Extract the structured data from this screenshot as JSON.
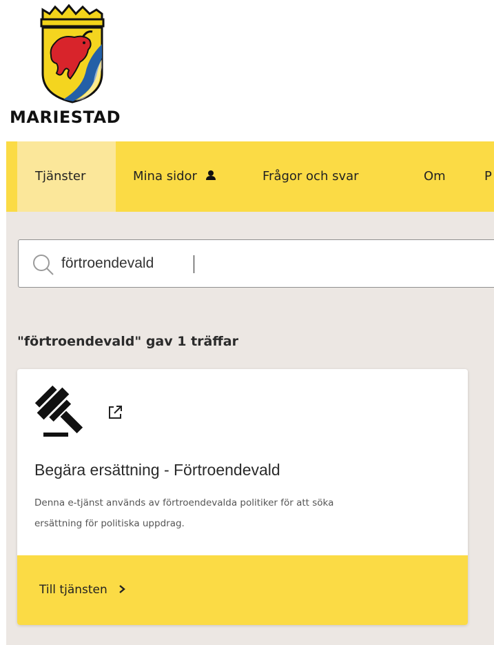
{
  "brand": {
    "name": "MARIESTAD"
  },
  "nav": {
    "items": [
      {
        "label": "Tjänster",
        "active": true
      },
      {
        "label": "Mina sidor",
        "icon": "user-icon"
      },
      {
        "label": "Frågor och svar"
      },
      {
        "label": "Om"
      },
      {
        "label": "P"
      }
    ]
  },
  "search": {
    "value": "förtroendevald",
    "icon": "search-icon"
  },
  "results": {
    "summary": "\"förtroendevald\" gav 1 träffar",
    "items": [
      {
        "icon": "gavel-icon",
        "external_icon": "external-link-icon",
        "title": "Begära ersättning - Förtroendevald",
        "description_line1": "Denna e-tjänst används av förtroendevalda politiker för att söka",
        "description_line2": "ersättning för politiska uppdrag.",
        "link_label": "Till tjänsten",
        "link_icon": "chevron-right-icon"
      }
    ]
  },
  "colors": {
    "nav_bg": "#fbdb45",
    "nav_active_bg": "#fbe79a",
    "page_bg": "#ece7e3",
    "card_footer_bg": "#fbdb45"
  }
}
